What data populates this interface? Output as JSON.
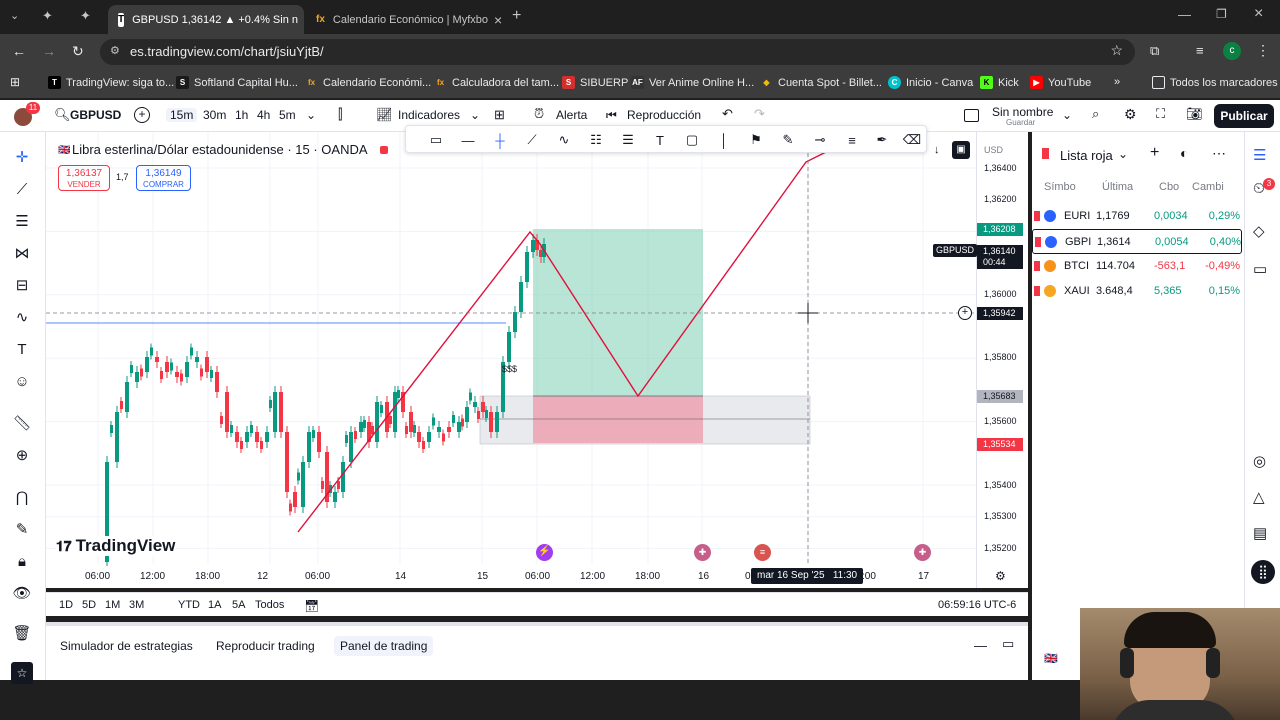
{
  "browser": {
    "tabs": [
      {
        "label": "GBPUSD 1,36142 ▲ +0.4% Sin n",
        "active": true
      },
      {
        "label": "Calendario Económico | Myfxbo",
        "active": false
      }
    ],
    "url": "es.tradingview.com/chart/jsiuYjtB/",
    "bookmarks": [
      "TradingView: siga to...",
      "Softland Capital Hu...",
      "Calendario Económi...",
      "Calculadora del tam...",
      "SIBUERP",
      "Ver Anime Online H...",
      "Cuenta Spot - Billet...",
      "Inicio - Canva",
      "Kick",
      "YouTube"
    ],
    "all_bookmarks": "Todos los marcadores"
  },
  "toolbar": {
    "notif_count": "11",
    "symbol": "GBPUSD",
    "intervals": [
      "15m",
      "30m",
      "1h",
      "4h",
      "5m"
    ],
    "indicators": "Indicadores",
    "alert": "Alerta",
    "replay": "Reproducción",
    "layout_name": "Sin nombre",
    "layout_sub": "Guardar",
    "publish": "Publicar"
  },
  "chart": {
    "title": "Libra esterlina/Dólar estadounidense · 15 · OANDA",
    "sell_price": "1,36137",
    "sell_label": "VENDER",
    "spread": "1,7",
    "buy_price": "1,36149",
    "buy_label": "COMPRAR",
    "logo": "TradingView",
    "annotation": "$$$",
    "currency": "USD",
    "price_labels": [
      "1,36400",
      "1,36200",
      "1,36000",
      "1,35800",
      "1,35600",
      "1,35400",
      "1,35300",
      "1,35200"
    ],
    "tags": {
      "target": "1,36208",
      "symbol_name": "GBPUSD",
      "current": "1,36140",
      "countdown": "00:44",
      "cursor": "1,35942",
      "entry": "1,35683",
      "stop": "1,35534"
    },
    "time_labels": [
      "06:00",
      "12:00",
      "18:00",
      "12",
      "06:00",
      "14",
      "15",
      "06:00",
      "12:00",
      "18:00",
      "16",
      "0",
      "17"
    ],
    "cursor_time": "mar 16 Sep '25   11:30",
    "cursor_time_end": ":00"
  },
  "ranges": [
    "1D",
    "5D",
    "1M",
    "3M",
    "YTD",
    "1A",
    "5A",
    "Todos"
  ],
  "clock": "06:59:16 UTC-6",
  "bottom_tabs": [
    "Simulador de estrategias",
    "Reproducir trading",
    "Panel de trading"
  ],
  "watchlist": {
    "title": "Lista roja",
    "headers": [
      "Símbo",
      "Última",
      "Cbo",
      "Cambi"
    ],
    "rows": [
      {
        "sym": "EURI",
        "last": "1,1769",
        "chg": "0,0034",
        "pct": "0,29%",
        "pos": true,
        "color": "#2962ff"
      },
      {
        "sym": "GBPI",
        "last": "1,3614",
        "chg": "0,0054",
        "pct": "0,40%",
        "pos": true,
        "color": "#2962ff"
      },
      {
        "sym": "BTCI",
        "last": "114.704",
        "chg": "-563,1",
        "pct": "-0,49%",
        "pos": false,
        "color": "#f7931a"
      },
      {
        "sym": "XAUI",
        "last": "3.648,4",
        "chg": "5,365",
        "pct": "0,15%",
        "pos": true,
        "color": "#f5a623"
      }
    ]
  },
  "right_badge": "3",
  "colors": {
    "up": "#089981",
    "down": "#f23645",
    "accent": "#2962ff",
    "zigzag": "#e0103b"
  }
}
